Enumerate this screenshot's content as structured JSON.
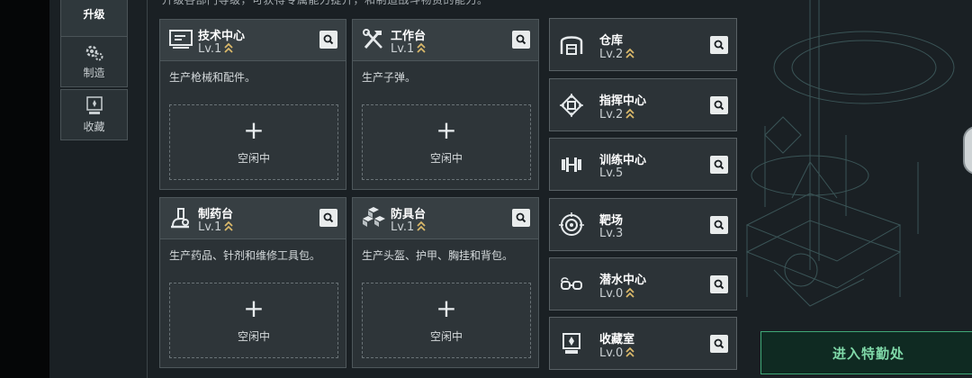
{
  "header": {
    "description": "升级各部门等级，可获得专属能力提升，和制造战斗物资的能力。"
  },
  "sidebar": {
    "items": [
      {
        "label": "升级",
        "active": true
      },
      {
        "label": "制造",
        "active": false
      },
      {
        "label": "收藏",
        "active": false
      }
    ]
  },
  "workshops": [
    {
      "name": "技术中心",
      "level": "Lv.1",
      "icon": "monitor-icon",
      "desc": "生产枪械和配件。",
      "slot": {
        "plus": "+",
        "status": "空闲中"
      }
    },
    {
      "name": "工作台",
      "level": "Lv.1",
      "icon": "tools-icon",
      "desc": "生产子弹。",
      "slot": {
        "plus": "+",
        "status": "空闲中"
      }
    },
    {
      "name": "制药台",
      "level": "Lv.1",
      "icon": "microscope-icon",
      "desc": "生产药品、针剂和维修工具包。",
      "slot": {
        "plus": "+",
        "status": "空闲中"
      }
    },
    {
      "name": "防具台",
      "level": "Lv.1",
      "icon": "cubes-icon",
      "desc": "生产头盔、护甲、胸挂和背包。",
      "slot": {
        "plus": "+",
        "status": "空闲中"
      }
    }
  ],
  "facilities": [
    {
      "name": "仓库",
      "level": "Lv.2",
      "icon": "warehouse-icon",
      "upgrade": true
    },
    {
      "name": "指挥中心",
      "level": "Lv.2",
      "icon": "chip-icon",
      "upgrade": true
    },
    {
      "name": "训练中心",
      "level": "Lv.5",
      "icon": "dumbbell-icon",
      "upgrade": false
    },
    {
      "name": "靶场",
      "level": "Lv.3",
      "icon": "target-icon",
      "upgrade": false
    },
    {
      "name": "潜水中心",
      "level": "Lv.0",
      "icon": "goggles-icon",
      "upgrade": true
    },
    {
      "name": "收藏室",
      "level": "Lv.0",
      "icon": "showcase-icon",
      "upgrade": true
    }
  ],
  "actions": {
    "enter": "进入特勤处"
  },
  "colors": {
    "accent": "#7fd8a8",
    "upgrade_chevron": "#d9b86a",
    "panel": "#2b3236"
  }
}
